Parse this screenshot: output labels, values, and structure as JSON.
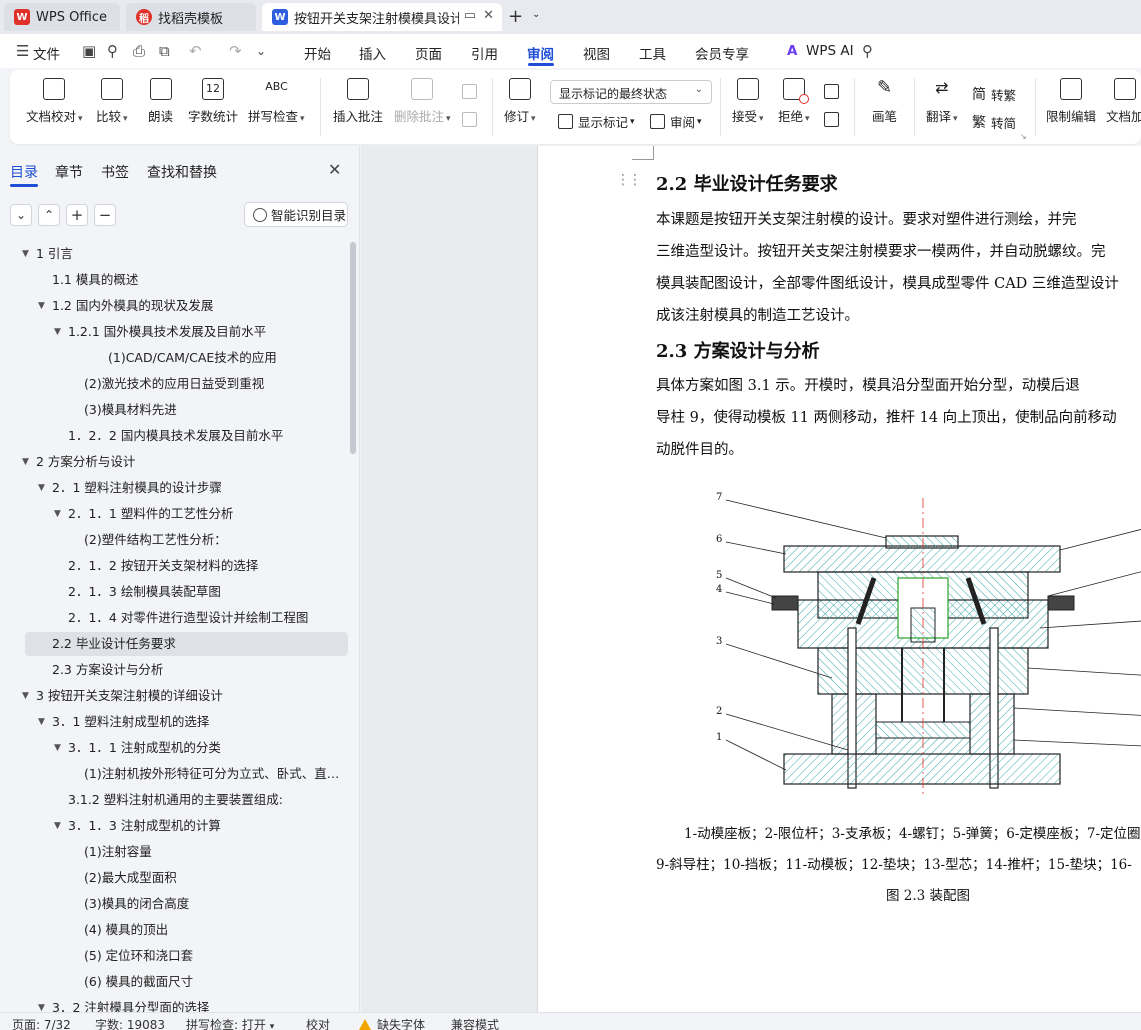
{
  "tabs": [
    {
      "label": "WPS Office",
      "icon": "wps-logo-icon",
      "active": false
    },
    {
      "label": "找稻壳模板",
      "icon": "docer-logo-icon",
      "active": false
    },
    {
      "label": "按钮开关支架注射模模具设计",
      "icon": "word-doc-icon",
      "active": true
    }
  ],
  "menu": {
    "file": "文件",
    "items": [
      "开始",
      "插入",
      "页面",
      "引用",
      "审阅",
      "视图",
      "工具",
      "会员专享"
    ],
    "active": "审阅",
    "wps_ai": "WPS AI"
  },
  "ribbon": {
    "doc_check": "文档校对",
    "compare": "比较",
    "read_aloud": "朗读",
    "word_count": "字数统计",
    "spell_check": "拼写检查",
    "spell_icon_text": "ABC",
    "insert_comment": "插入批注",
    "delete_comment": "删除批注",
    "track_changes": "修订",
    "markup_state": "显示标记的最终状态",
    "show_markup": "显示标记",
    "review": "审阅",
    "accept": "接受",
    "reject": "拒绝",
    "pen": "画笔",
    "translate": "翻译",
    "to_traditional": "转繁",
    "to_simplified": "转简",
    "restrict_edit": "限制编辑",
    "doc_encrypt": "文档加"
  },
  "nav": {
    "tabs": [
      "目录",
      "章节",
      "书签",
      "查找和替换"
    ],
    "smart_toc": "智能识别目录",
    "toc": [
      {
        "text": "1  引言",
        "level": 0,
        "caret": true
      },
      {
        "text": "1.1   模具的概述",
        "level": 1,
        "caret": false
      },
      {
        "text": "1.2   国内外模具的现状及发展",
        "level": 1,
        "caret": true
      },
      {
        "text": "1.2.1   国外模具技术发展及目前水平",
        "level": 2,
        "caret": true
      },
      {
        "text": "(1)CAD/CAM/CAE技术的应用",
        "level": 4,
        "caret": false
      },
      {
        "text": "(2)激光技术的应用日益受到重视",
        "level": 3,
        "caret": false
      },
      {
        "text": "(3)模具材料先进",
        "level": 3,
        "caret": false
      },
      {
        "text": "1．2．2   国内模具技术发展及目前水平",
        "level": 2,
        "caret": false
      },
      {
        "text": "2   方案分析与设计",
        "level": 0,
        "caret": true
      },
      {
        "text": "2．1   塑料注射模具的设计步骤",
        "level": 1,
        "caret": true
      },
      {
        "text": "2．1．1   塑料件的工艺性分析",
        "level": 2,
        "caret": true
      },
      {
        "text": "(2)塑件结构工艺性分析：",
        "level": 3,
        "caret": false
      },
      {
        "text": "2．1．2   按钮开关支架材料的选择",
        "level": 2,
        "caret": false
      },
      {
        "text": "2．1．3   绘制模具装配草图",
        "level": 2,
        "caret": false
      },
      {
        "text": "2．1．4   对零件进行造型设计并绘制工程图",
        "level": 2,
        "caret": false
      },
      {
        "text": "2.2   毕业设计任务要求",
        "level": 1,
        "caret": false,
        "selected": true
      },
      {
        "text": "2.3   方案设计与分析",
        "level": 1,
        "caret": false
      },
      {
        "text": "3   按钮开关支架注射模的详细设计",
        "level": 0,
        "caret": true
      },
      {
        "text": "3．1   塑料注射成型机的选择",
        "level": 1,
        "caret": true
      },
      {
        "text": "3．1．1   注射成型机的分类",
        "level": 2,
        "caret": true
      },
      {
        "text": "(1)注射机按外形特征可分为立式、卧式、直角式...",
        "level": 3,
        "caret": false
      },
      {
        "text": "3.1.2   塑料注射机通用的主要装置组成:",
        "level": 2,
        "caret": false
      },
      {
        "text": "3．1．3   注射成型机的计算",
        "level": 2,
        "caret": true
      },
      {
        "text": "(1)注射容量",
        "level": 3,
        "caret": false
      },
      {
        "text": "(2)最大成型面积",
        "level": 3,
        "caret": false
      },
      {
        "text": "(3)模具的闭合高度",
        "level": 3,
        "caret": false
      },
      {
        "text": "(4) 模具的顶出",
        "level": 3,
        "caret": false
      },
      {
        "text": "(5) 定位环和浇口套",
        "level": 3,
        "caret": false
      },
      {
        "text": "(6) 模具的截面尺寸",
        "level": 3,
        "caret": false
      },
      {
        "text": "3．2   注射模具分型面的选择",
        "level": 1,
        "caret": true
      }
    ]
  },
  "document": {
    "h_22": "2.2   毕业设计任务要求",
    "p1": [
      "    本课题是按钮开关支架注射模的设计。要求对塑件进行测绘，并完",
      "三维造型设计。按钮开关支架注射模要求一模两件，并自动脱螺纹。完",
      "模具装配图设计，全部零件图纸设计，模具成型零件 CAD 三维造型设计",
      "成该注射模具的制造工艺设计。"
    ],
    "h_23": "2.3   方案设计与分析",
    "p2": [
      "    具体方案如图 3.1 示。开模时，模具沿分型面开始分型，动模后退",
      "导柱 9，使得动模板 11 两侧移动，推杆 14 向上顶出，使制品向前移动",
      "动脱件目的。"
    ],
    "figure_labels": [
      "7",
      "6",
      "5",
      "4",
      "3",
      "2",
      "1"
    ],
    "caption_line1": "1-动模座板；2-限位杆；3-支承板；4-螺钉；5-弹簧；6-定模座板；7-定位圈",
    "caption_line2": "9-斜导柱；10-挡板；11-动模板；12-垫块；13-型芯；14-推杆；15-垫块；16-",
    "figure_title": "图 2.3   装配图"
  },
  "status": {
    "page": "页面: 7/32",
    "words": "字数: 19083",
    "spell": "拼写检查: 打开",
    "proof": "校对",
    "missing_font": "缺失字体",
    "compat": "兼容模式"
  }
}
